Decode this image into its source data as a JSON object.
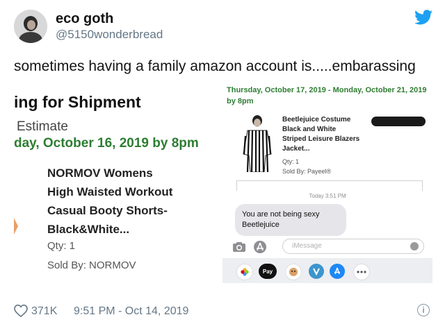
{
  "tweet": {
    "display_name": "eco goth",
    "handle": "@5150wonderbread",
    "text": "sometimes having a family amazon account is.....embarassing",
    "likes": "371K",
    "timestamp": "9:51 PM - Oct 14, 2019"
  },
  "left_screenshot": {
    "title": "ing for Shipment",
    "estimate_label": "Estimate",
    "delivery_date": "day, October 16, 2019 by 8pm",
    "product_line1": "NORMOV Womens",
    "product_line2": "High Waisted Workout",
    "product_line3": "Casual Booty Shorts-",
    "product_line4": "Black&White...",
    "qty": "Qty: 1",
    "sold_by": "Sold By: NORMOV"
  },
  "right_screenshot": {
    "delivery_date": "Thursday, October 17, 2019 - Monday, October 21, 2019 by 8pm",
    "product_line1": "Beetlejuice Costume",
    "product_line2": "Black and White",
    "product_line3": "Striped Leisure Blazers",
    "product_line4": "Jacket...",
    "qty": "Qty: 1",
    "sold_by": "Sold By: Payeel®",
    "today_label": "Today 3:51 PM",
    "message": "You are not being sexy Beetlejuice",
    "compose_placeholder": "iMessage",
    "apple_pay_label": "Pay"
  },
  "icons": [
    "twitter-bird-icon",
    "heart-icon",
    "info-icon",
    "camera-icon",
    "app-store-icon",
    "mic-icon",
    "photos-icon",
    "apple-pay-icon",
    "memoji-icon",
    "venmo-icon",
    "more-icon"
  ],
  "colors": {
    "twitter_blue": "#1da1f2",
    "amazon_green": "#2e7d32",
    "meta_gray": "#657786"
  }
}
